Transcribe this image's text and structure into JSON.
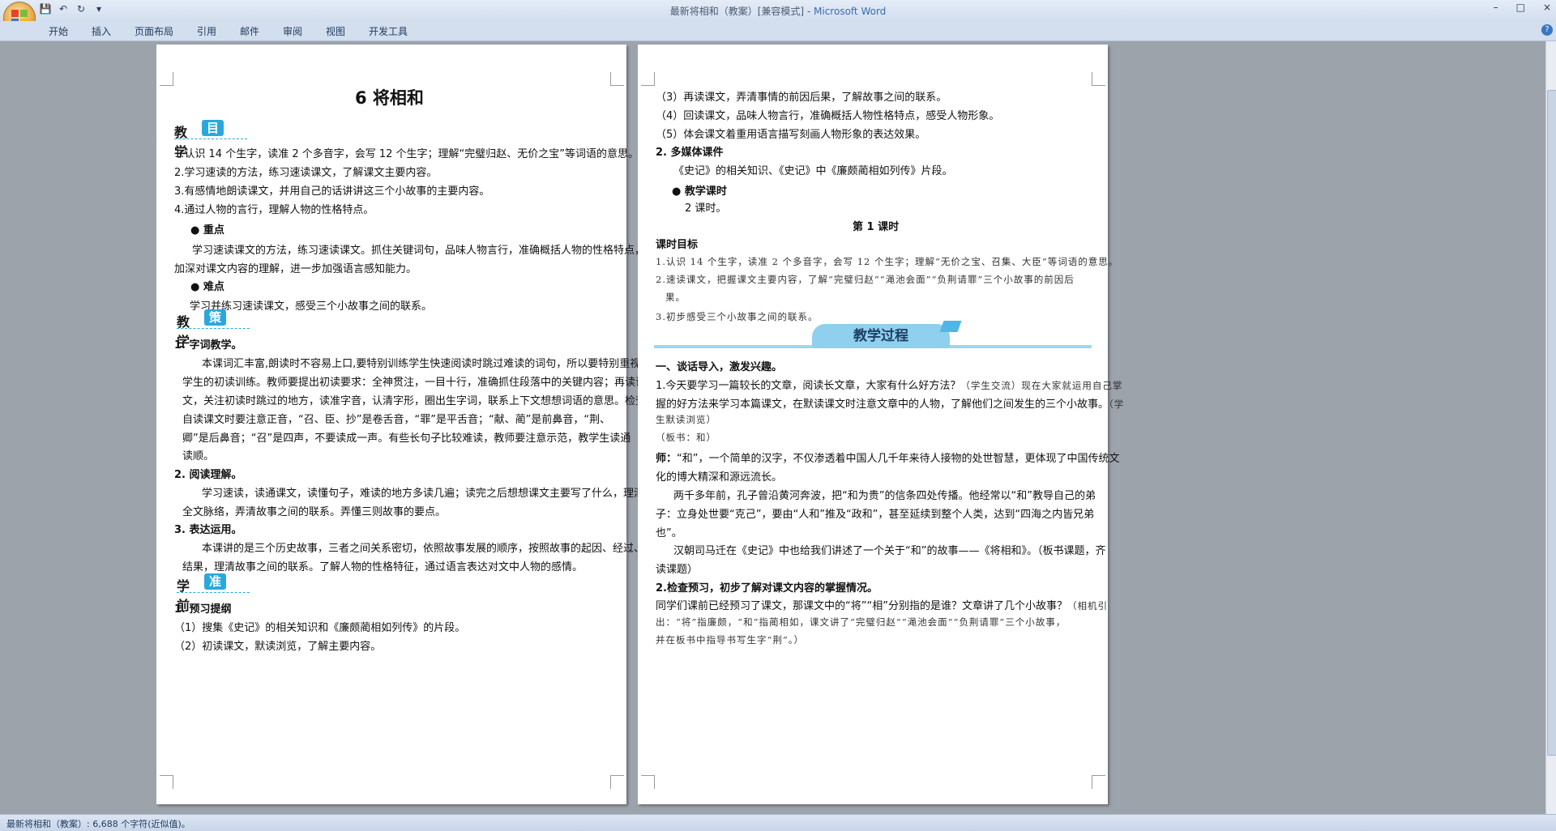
{
  "window": {
    "title": "最新将相和（教案）[兼容模式] - ",
    "app_name": "Microsoft Word",
    "controls": [
      "–",
      "□",
      "×"
    ]
  },
  "qat": {
    "save": "💾",
    "undo": "↶",
    "redo": "↻",
    "more": "▾"
  },
  "ribbon": {
    "tabs": [
      "开始",
      "插入",
      "页面布局",
      "引用",
      "邮件",
      "审阅",
      "视图",
      "开发工具"
    ],
    "help": "?"
  },
  "page1": {
    "title": "6  将相和",
    "goals_head": {
      "a": "教学",
      "b": "目标"
    },
    "goals": [
      "1.认识 14 个生字，读准 2 个多音字，会写 12 个生字；理解“完璧归赵、无价之宝”等词语的意思。",
      "2.学习速读的方法，练习速读课文，了解课文主要内容。",
      "3.有感情地朗读课文，并用自己的话讲讲这三个小故事的主要内容。",
      "4.通过人物的言行，理解人物的性格特点。"
    ],
    "key_label": "●  重点",
    "key_text": [
      "学习速读课文的方法，练习速读课文。抓住关键词句，品味人物言行，准确概括人物的性格特点，",
      "加深对课文内容的理解，进一步加强语言感知能力。"
    ],
    "diff_label": "●  难点",
    "diff_text": "学习并练习速读课文，感受三个小故事之间的联系。",
    "strategy_head": {
      "a": "教学",
      "b": "策略"
    },
    "s1_title": "1. 字词教学。",
    "s1_lines": [
      "本课词汇丰富,朗读时不容易上口,要特别训练学生快速阅读时跳过难读的词句，所以要特别重视",
      "学生的初读训练。教师要提出初读要求：全神贯注，一目十行，准确抓住段落中的关键内容；再读课",
      "文，关注初读时跳过的地方，读准字音，认清字形，圈出生字词，联系上下文想想词语的意思。检查",
      "自读课文时要注意正音，“召、臣、抄”是卷舌音，“罪”是平舌音；“献、蔺”是前鼻音，“荆、",
      "卿”是后鼻音；“召”是四声，不要读成一声。有些长句子比较难读，教师要注意示范，教学生读通",
      "读顺。"
    ],
    "s2_title": "2. 阅读理解。",
    "s2_lines": [
      "学习速读，读通课文，读懂句子，难读的地方多读几遍；读完之后想想课文主要写了什么，理清",
      "全文脉络，弄清故事之间的联系。弄懂三则故事的要点。"
    ],
    "s3_title": "3. 表达运用。",
    "s3_lines": [
      "本课讲的是三个历史故事，三者之间关系密切，依照故事发展的顺序，按照故事的起因、经过、",
      "结果，理清故事之间的联系。了解人物的性格特征，通过语言表达对文中人物的感情。"
    ],
    "prep_head": {
      "a": "学前",
      "b": "准备"
    },
    "prep_title": "1. 预习提纲",
    "prep_lines": [
      "（1）搜集《史记》的相关知识和《廉颇蔺相如列传》的片段。",
      "（2）初读课文，默读浏览，了解主要内容。"
    ]
  },
  "page2": {
    "prep_lines": [
      "（3）再读课文，弄清事情的前因后果，了解故事之间的联系。",
      "（4）回读课文，品味人物言行，准确概括人物性格特点，感受人物形象。",
      "（5）体会课文着重用语言描写刻画人物形象的表达效果。"
    ],
    "media_title": "2. 多媒体课件",
    "media_text": "《史记》的相关知识、《史记》中《廉颇蔺相如列传》片段。",
    "hours_label": "●  教学课时",
    "hours_text": "2 课时。",
    "lesson_title": "第 1 课时",
    "lesson_goal_title": "课时目标",
    "lesson_goals": [
      "1.认识 14 个生字，读准 2 个多音字，会写 12 个生字；理解“无价之宝、召集、大臣”等词语的意思。",
      "2.速读课文，把握课文主要内容，了解“完璧归赵”“渑池会面”“负荆请罪”三个小故事的前因后",
      "果。",
      "3.初步感受三个小故事之间的联系。"
    ],
    "banner": "教学过程",
    "p1_title": "一、谈话导入，激发兴趣。",
    "p1_lines": [
      "1.今天要学习一篇较长的文章，阅读长文章，大家有什么好方法？",
      "握的好方法来学习本篇课文，在默读课文时注意文章中的人物，了解他们之间发生的三个小故事。"
    ],
    "p1_note1": "（学生交流）现在大家就运用自己掌",
    "p1_note2": "（学",
    "p1_note3": "生默读浏览）",
    "p1_board": "（板书：和）",
    "teacher_label": "师：",
    "teacher_lines": [
      "“和”，一个简单的汉字，不仅渗透着中国人几千年来待人接物的处世智慧，更体现了中国传统文",
      "化的博大精深和源远流长。"
    ],
    "para2": [
      "两千多年前，孔子曾沿黄河奔波，把“和为贵”的信条四处传播。他经常以“和”教导自己的弟",
      "子：立身处世要“克己”，要由“人和”推及“政和”，甚至延续到整个人类，达到“四海之内皆兄弟",
      "也”。"
    ],
    "para3": [
      "汉朝司马迁在《史记》中也给我们讲述了一个关于“和”的故事——《将相和》。（板书课题，齐",
      "读课题）"
    ],
    "p2_title": "2.检查预习，初步了解对课文内容的掌握情况。",
    "p2_line1": "同学们课前已经预习了课文，那课文中的“将”“相”分别指的是谁？文章讲了几个小故事？",
    "p2_note1": "（相机引",
    "p2_note2": "出：“将”指廉颇，“和”指蔺相如，课文讲了“完璧归赵”“渑池会面”“负荆请罪”三个小故事，",
    "p2_note3": "并在板书中指导书写生字“荆”。）"
  },
  "status": {
    "text": "最新将相和（教案）: 6,688 个字符(近似值)。"
  }
}
